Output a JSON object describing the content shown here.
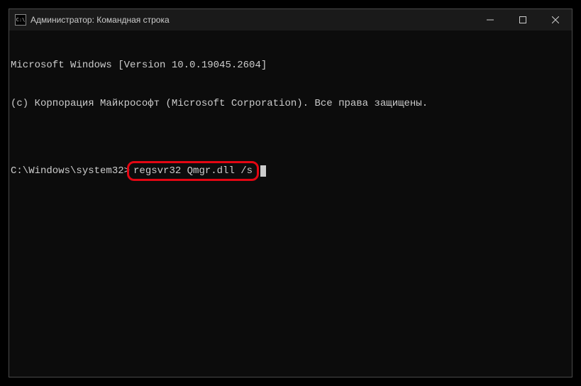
{
  "window": {
    "title": "Администратор: Командная строка",
    "icon_text": "C:\\"
  },
  "terminal": {
    "line1": "Microsoft Windows [Version 10.0.19045.2604]",
    "line2": "(c) Корпорация Майкрософт (Microsoft Corporation). Все права защищены.",
    "blank": "",
    "prompt": "C:\\Windows\\system32>",
    "command": "regsvr32 Qmgr.dll /s"
  }
}
